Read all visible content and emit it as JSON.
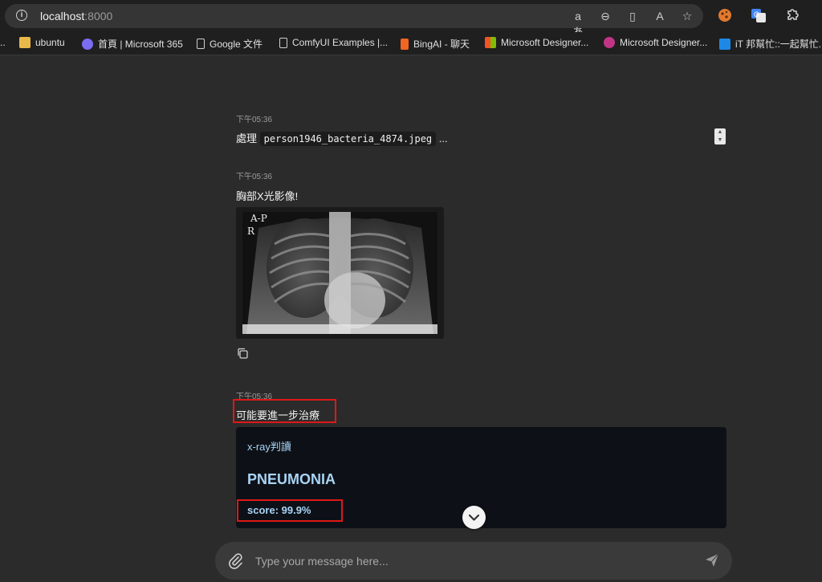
{
  "browser": {
    "url_host": "localhost",
    "url_port": ":8000",
    "addr_icons": [
      "aあ",
      "⊖",
      "▯",
      "A",
      "☆"
    ],
    "ext_icons": [
      "puzzle",
      "translate",
      "extensions"
    ],
    "bookmarks": [
      {
        "label": "ubuntu",
        "icon": "folder-icon",
        "color": "#e8b94a"
      },
      {
        "label": "首頁 | Microsoft 365",
        "icon": "m365-icon",
        "color": "#7b6cf0"
      },
      {
        "label": "Google 文件",
        "icon": "doc-icon",
        "color": "#cfcfcf"
      },
      {
        "label": "ComfyUI Examples |...",
        "icon": "doc-icon",
        "color": "#cfcfcf"
      },
      {
        "label": "BingAI - 聊天",
        "icon": "bing-icon",
        "color": "#f26522"
      },
      {
        "label": "Microsoft Designer...",
        "icon": "microsoft-icon",
        "color": "#f35325"
      },
      {
        "label": "Microsoft Designer...",
        "icon": "designer-icon",
        "color": "#c13584"
      },
      {
        "label": "iT 邦幫忙::一起幫忙...",
        "icon": "ithome-icon",
        "color": "#1e88e5"
      }
    ]
  },
  "chat": {
    "messages": [
      {
        "time": "下午05:36",
        "prefix": "處理",
        "file": "person1946_bacteria_4874.jpeg",
        "suffix": "..."
      },
      {
        "time": "下午05:36",
        "text": "胸部X光影像!"
      },
      {
        "time": "下午05:36",
        "text": "可能要進一步治療"
      }
    ],
    "xray_marker_top": "A-P",
    "xray_marker_side": "R",
    "result": {
      "title": "x-ray判讀",
      "label": "PNEUMONIA",
      "score": "score: 99.9%"
    }
  },
  "input": {
    "placeholder": "Type your message here..."
  }
}
